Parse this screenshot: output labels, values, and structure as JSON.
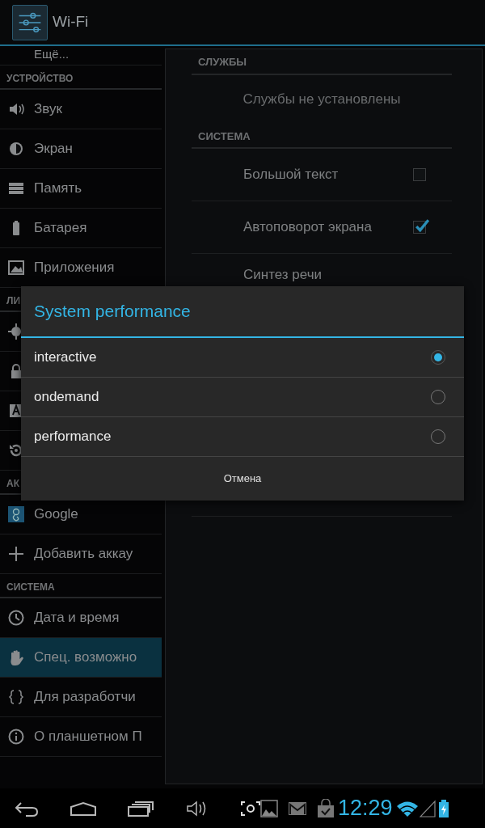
{
  "action_bar": {
    "title": "Wi-Fi"
  },
  "sidebar": {
    "items": [
      {
        "kind": "item",
        "label": "Ещё...",
        "selected": false
      },
      {
        "kind": "header",
        "label": "УСТРОЙСТВО"
      },
      {
        "kind": "item",
        "label": "Звук",
        "selected": false
      },
      {
        "kind": "item",
        "label": "Экран",
        "selected": false
      },
      {
        "kind": "item",
        "label": "Память",
        "selected": false
      },
      {
        "kind": "item",
        "label": "Батарея",
        "selected": false
      },
      {
        "kind": "item",
        "label": "Приложения",
        "selected": false
      },
      {
        "kind": "header",
        "label": "ЛИ"
      },
      {
        "kind": "covered",
        "selected": false
      },
      {
        "kind": "covered",
        "selected": false
      },
      {
        "kind": "covered",
        "selected": false
      },
      {
        "kind": "covered",
        "selected": false
      },
      {
        "kind": "header",
        "label": "АК"
      },
      {
        "kind": "item",
        "label": "Google",
        "selected": false
      },
      {
        "kind": "item",
        "label": "Добавить аккау",
        "selected": false
      },
      {
        "kind": "header",
        "label": "СИСТЕМА"
      },
      {
        "kind": "item",
        "label": "Дата и время",
        "selected": false
      },
      {
        "kind": "item",
        "label": "Спец. возможно",
        "selected": true
      },
      {
        "kind": "item",
        "label": "Для разработчи",
        "selected": false
      },
      {
        "kind": "item",
        "label": "О планшетном П",
        "selected": false
      }
    ]
  },
  "panel": {
    "sections": [
      {
        "header": "СЛУЖБЫ",
        "rows": [
          {
            "kind": "note",
            "label": "Службы не установлены"
          }
        ]
      },
      {
        "header": "СИСТЕМА",
        "rows": [
          {
            "kind": "checkbox",
            "label": "Большой текст",
            "checked": false
          },
          {
            "kind": "checkbox",
            "label": "Автоповорот экрана",
            "checked": true
          },
          {
            "kind": "plain",
            "label": "Синтез речи"
          }
        ]
      }
    ]
  },
  "dialog": {
    "title": "System performance",
    "options": [
      {
        "label": "interactive",
        "selected": true
      },
      {
        "label": "ondemand",
        "selected": false
      },
      {
        "label": "performance",
        "selected": false
      }
    ],
    "button": "Отмена"
  },
  "nav_bar": {
    "clock": "12:29"
  }
}
